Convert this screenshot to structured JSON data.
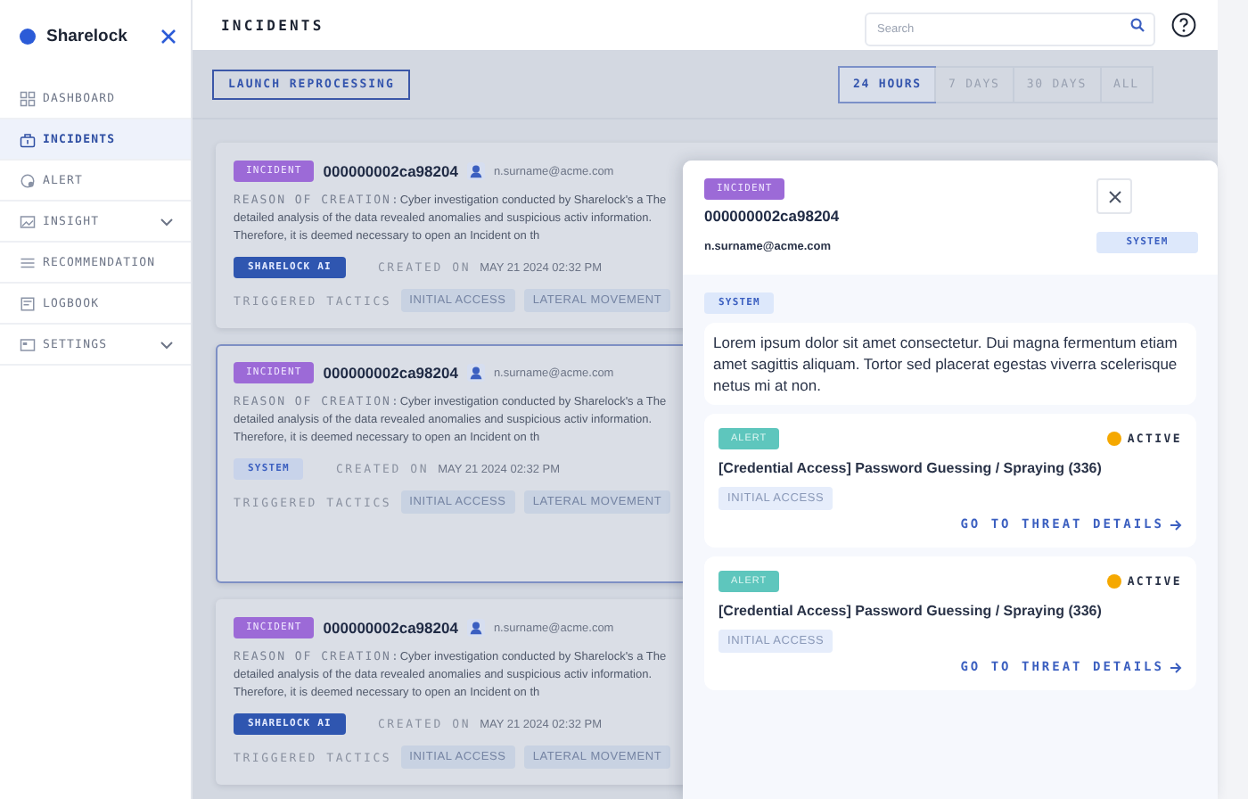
{
  "sidebar": {
    "brand": "Sharelock",
    "items": [
      {
        "label": "DASHBOARD",
        "selected": false,
        "has_submenu": false
      },
      {
        "label": "INCIDENTS",
        "selected": true,
        "has_submenu": false
      },
      {
        "label": "ALERT",
        "selected": false,
        "has_submenu": false
      },
      {
        "label": "INSIGHT",
        "selected": false,
        "has_submenu": true
      },
      {
        "label": "RECOMMENDATION",
        "selected": false,
        "has_submenu": false
      },
      {
        "label": "LOGBOOK",
        "selected": false,
        "has_submenu": false
      },
      {
        "label": "SETTINGS",
        "selected": false,
        "has_submenu": true
      }
    ]
  },
  "header": {
    "title": "INCIDENTS",
    "search": {
      "placeholder": "Search"
    }
  },
  "toolbar": {
    "launch_button": "LAUNCH REPROCESSING",
    "ranges": [
      {
        "label": "24 HOURS",
        "selected": true
      },
      {
        "label": "7 DAYS",
        "selected": false
      },
      {
        "label": "30 DAYS",
        "selected": false
      },
      {
        "label": "ALL",
        "selected": false
      }
    ]
  },
  "incidents": [
    {
      "badge": "INCIDENT",
      "id": "000000002ca98204",
      "email": "n.surname@acme.com",
      "reason_label": "REASON OF CREATION:",
      "reason": "Cyber investigation  conducted by Sharelock's a The detailed analysis of the data revealed  anomalies and suspicious activ information. Therefore, it is deemed necessary to  open an Incident on th",
      "source": {
        "label": "SHARELOCK AI",
        "kind": "ai"
      },
      "created_label": "CREATED ON",
      "created": "MAY 21 2024 02:32 PM",
      "tactics_label": "TRIGGERED TACTICS",
      "tactics": [
        "INITIAL ACCESS",
        "LATERAL MOVEMENT"
      ],
      "selected": false
    },
    {
      "badge": "INCIDENT",
      "id": "000000002ca98204",
      "email": "n.surname@acme.com",
      "reason_label": "REASON OF CREATION:",
      "reason": "Cyber investigation  conducted by Sharelock's a The detailed analysis of the data revealed  anomalies and suspicious activ information. Therefore, it is deemed necessary to  open an Incident on th",
      "source": {
        "label": "SYSTEM",
        "kind": "system"
      },
      "created_label": "CREATED ON",
      "created": "MAY 21 2024 02:32 PM",
      "tactics_label": "TRIGGERED TACTICS",
      "tactics": [
        "INITIAL ACCESS",
        "LATERAL MOVEMENT"
      ],
      "selected": true
    },
    {
      "badge": "INCIDENT",
      "id": "000000002ca98204",
      "email": "n.surname@acme.com",
      "reason_label": "REASON OF CREATION:",
      "reason": "Cyber investigation  conducted by Sharelock's a The detailed analysis of the data revealed  anomalies and suspicious activ information. Therefore, it is deemed necessary to  open an Incident on th",
      "source": {
        "label": "SHARELOCK AI",
        "kind": "ai"
      },
      "created_label": "CREATED ON",
      "created": "MAY 21 2024 02:32 PM",
      "tactics_label": "TRIGGERED TACTICS",
      "tactics": [
        "INITIAL ACCESS",
        "LATERAL MOVEMENT"
      ],
      "selected": false
    }
  ],
  "drawer": {
    "badge": "INCIDENT",
    "id": "000000002ca98204",
    "email": "n.surname@acme.com",
    "source_tag": "SYSTEM",
    "comment": {
      "tag": "SYSTEM",
      "text": "Lorem ipsum dolor sit amet consectetur. Dui magna fermentum etiam amet sagittis aliquam. Tortor sed placerat egestas viverra scelerisque netus mi at non."
    },
    "alerts": [
      {
        "badge": "ALERT",
        "status": "ACTIVE",
        "title": "[Credential Access] Password Guessing / Spraying (336)",
        "tactics": [
          "INITIAL ACCESS"
        ],
        "link": "GO TO THREAT DETAILS"
      },
      {
        "badge": "ALERT",
        "status": "ACTIVE",
        "title": "[Credential Access] Password Guessing / Spraying (336)",
        "tactics": [
          "INITIAL ACCESS"
        ],
        "link": "GO TO THREAT DETAILS"
      }
    ]
  }
}
